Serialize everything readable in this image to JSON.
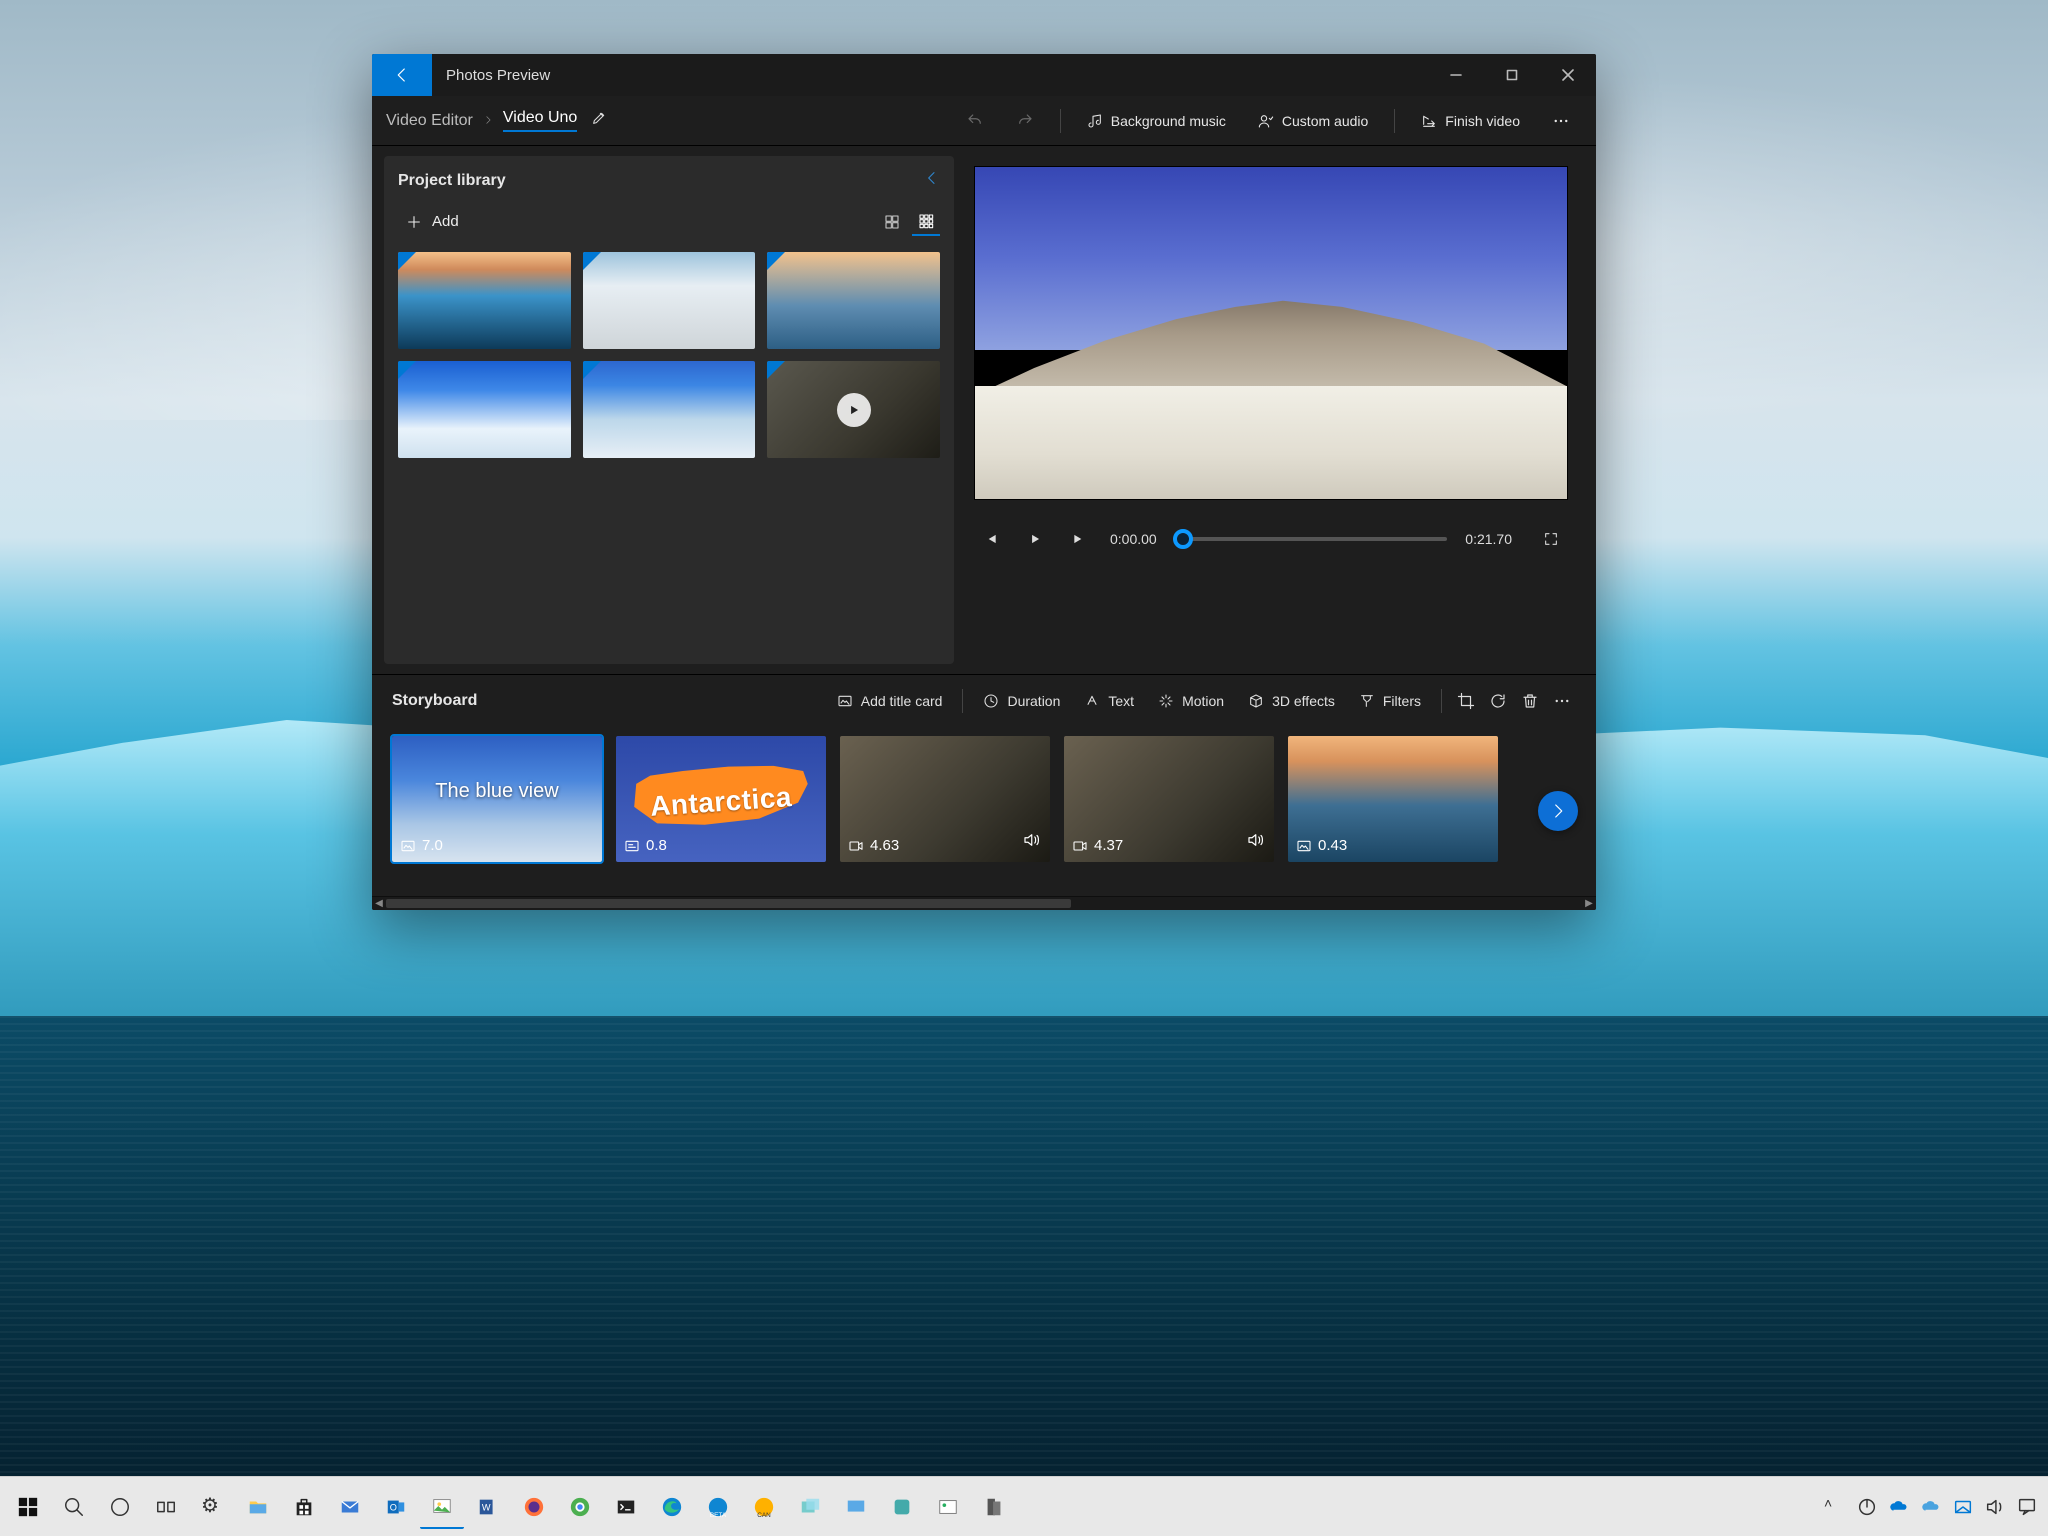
{
  "window": {
    "title": "Photos Preview",
    "breadcrumbs": [
      "Video Editor",
      "Video Uno"
    ]
  },
  "toolbar": {
    "undo": "Undo",
    "redo": "Redo",
    "bg_music": "Background music",
    "custom_audio": "Custom audio",
    "finish": "Finish video",
    "more": "More"
  },
  "library": {
    "title": "Project library",
    "add": "Add"
  },
  "player": {
    "current": "0:00.00",
    "total": "0:21.70"
  },
  "storyboard": {
    "title": "Storyboard",
    "add_title_card": "Add title card",
    "duration": "Duration",
    "text": "Text",
    "motion": "Motion",
    "effects3d": "3D effects",
    "filters": "Filters",
    "clips": [
      {
        "label": "The blue view",
        "duration": "7.0",
        "type": "image",
        "audio": false
      },
      {
        "label": "Antarctica",
        "duration": "0.8",
        "type": "title",
        "audio": false
      },
      {
        "label": "",
        "duration": "4.63",
        "type": "video",
        "audio": true
      },
      {
        "label": "",
        "duration": "4.37",
        "type": "video",
        "audio": true
      },
      {
        "label": "",
        "duration": "0.43",
        "type": "image",
        "audio": false
      }
    ]
  },
  "taskbar": {
    "time": "",
    "tray": [
      "up",
      "power",
      "onedrive",
      "cloud",
      "settings-sync",
      "volume",
      "action-center"
    ]
  }
}
